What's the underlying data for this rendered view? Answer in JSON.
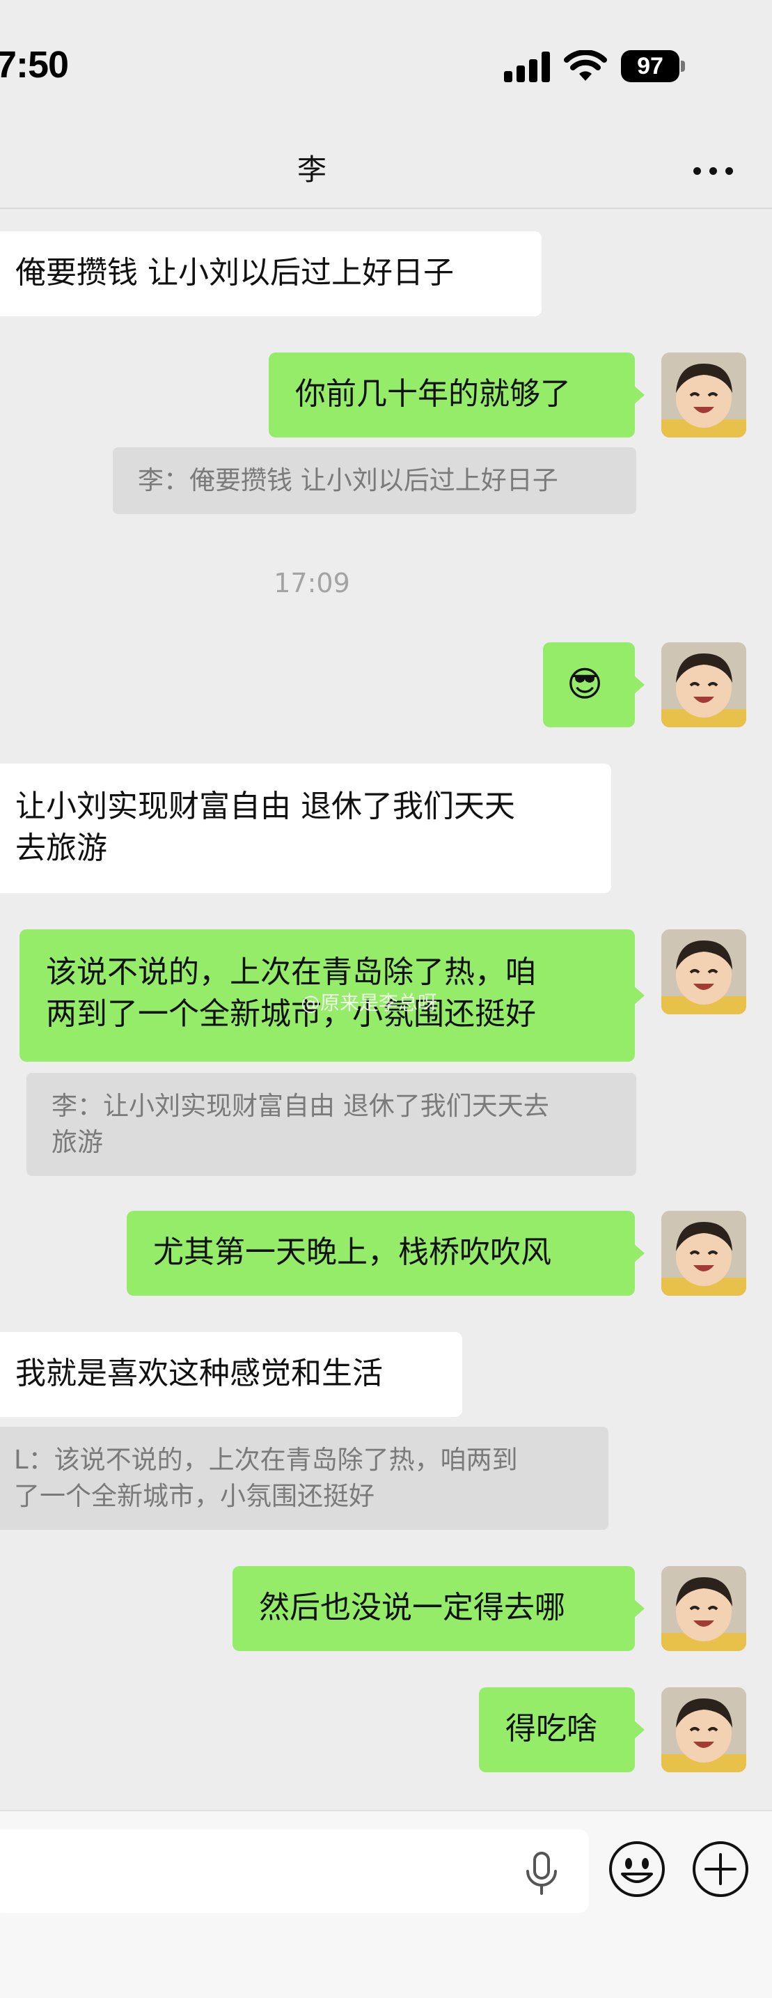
{
  "status_bar": {
    "time": "7:50",
    "battery": "97"
  },
  "header": {
    "title": "李"
  },
  "messages": {
    "m1": {
      "text": "俺要攒钱 让小刘以后过上好日子"
    },
    "m2": {
      "text": "你前几十年的就够了",
      "quote": "李：俺要攒钱 让小刘以后过上好日子"
    },
    "timestamp": "17:09",
    "m3": {
      "emoji": "😎"
    },
    "m4": {
      "line1": "让小刘实现财富自由 退休了我们天天",
      "line2": "去旅游"
    },
    "m5": {
      "line1": "该说不说的，上次在青岛除了热，咱",
      "line2": "两到了一个全新城市，小氛围还挺好",
      "quote_line1": "李：让小刘实现财富自由 退休了我们天天去",
      "quote_line2": "旅游"
    },
    "m6": {
      "text": "尤其第一天晚上，栈桥吹吹风"
    },
    "m7": {
      "text": "我就是喜欢这种感觉和生活",
      "quote_line1": "L：该说不说的，上次在青岛除了热，咱两到",
      "quote_line2": "了一个全新城市，小氛围还挺好"
    },
    "m8": {
      "text": "然后也没说一定得去哪"
    },
    "m9": {
      "text": "得吃啥"
    }
  },
  "watermark": "@原来是李总呀",
  "input_bar": {
    "placeholder": ""
  },
  "colors": {
    "outgoing_bubble": "#95ec69",
    "incoming_bubble": "#ffffff",
    "background": "#ededed",
    "quote_bg": "#dcdcdc"
  },
  "icons": [
    "signal-icon",
    "wifi-icon",
    "battery-icon",
    "more-icon",
    "microphone-icon",
    "emoji-icon",
    "plus-icon"
  ]
}
